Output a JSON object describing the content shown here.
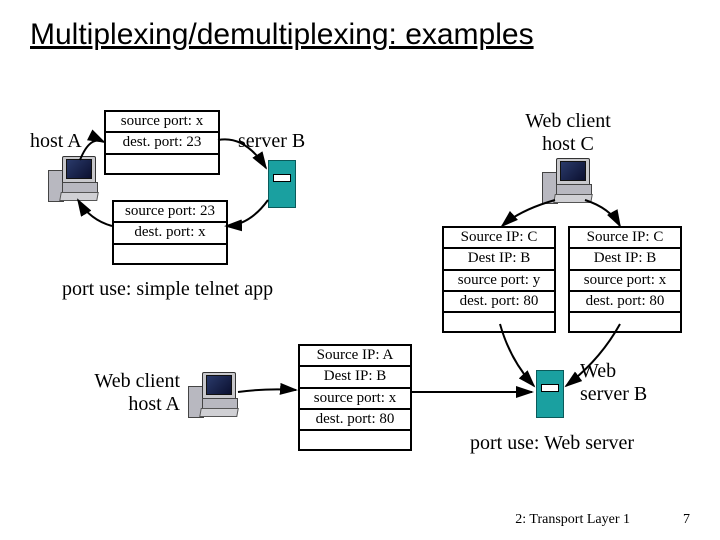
{
  "title": "Multiplexing/demultiplexing: examples",
  "labels": {
    "host_a": "host A",
    "server_b_top": "server B",
    "web_client_c": "Web client\nhost C",
    "web_client_a": "Web client\nhost A",
    "web_server_b": "Web\nserver B"
  },
  "captions": {
    "telnet": "port use: simple telnet app",
    "web": "port use: Web server"
  },
  "packets": {
    "p1": {
      "lines": [
        "source port: x",
        "dest. port: 23"
      ]
    },
    "p2": {
      "lines": [
        "source port: 23",
        "dest. port: x"
      ]
    },
    "p3": {
      "lines": [
        "Source IP: C",
        "Dest IP: B",
        "source port: y",
        "dest. port: 80"
      ]
    },
    "p4": {
      "lines": [
        "Source IP: C",
        "Dest IP: B",
        "source port: x",
        "dest. port: 80"
      ]
    },
    "p5": {
      "lines": [
        "Source IP: A",
        "Dest IP: B",
        "source port: x",
        "dest. port: 80"
      ]
    }
  },
  "footer": {
    "section": "2: Transport Layer 1",
    "page": "7"
  },
  "chart_data": {
    "type": "table",
    "title": "Multiplexing/demultiplexing: examples",
    "nodes": [
      {
        "id": "host_a_top",
        "role": "client",
        "label": "host A"
      },
      {
        "id": "server_b_top",
        "role": "server",
        "label": "server B"
      },
      {
        "id": "host_c",
        "role": "client",
        "label": "Web client host C"
      },
      {
        "id": "host_a_web",
        "role": "client",
        "label": "Web client host A"
      },
      {
        "id": "server_b_web",
        "role": "server",
        "label": "Web server B"
      }
    ],
    "segments": [
      {
        "from": "host_a_top",
        "to": "server_b_top",
        "source_port": "x",
        "dest_port": "23",
        "scenario": "simple telnet app"
      },
      {
        "from": "server_b_top",
        "to": "host_a_top",
        "source_port": "23",
        "dest_port": "x",
        "scenario": "simple telnet app"
      },
      {
        "from": "host_c",
        "to": "server_b_web",
        "source_ip": "C",
        "dest_ip": "B",
        "source_port": "y",
        "dest_port": "80",
        "scenario": "Web server"
      },
      {
        "from": "host_c",
        "to": "server_b_web",
        "source_ip": "C",
        "dest_ip": "B",
        "source_port": "x",
        "dest_port": "80",
        "scenario": "Web server"
      },
      {
        "from": "host_a_web",
        "to": "server_b_web",
        "source_ip": "A",
        "dest_ip": "B",
        "source_port": "x",
        "dest_port": "80",
        "scenario": "Web server"
      }
    ]
  }
}
